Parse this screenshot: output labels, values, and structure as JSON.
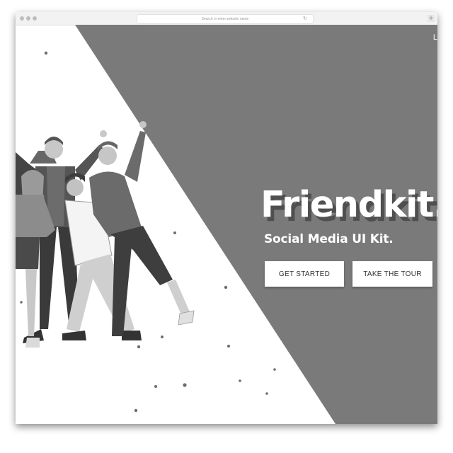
{
  "browser": {
    "url_placeholder": "Search or enter website name",
    "reload_icon": "reload-icon",
    "new_tab_icon": "plus-icon",
    "new_tab_glyph": "+"
  },
  "hero": {
    "title": "Friendkit.",
    "subtitle": "Social Media UI Kit.",
    "corner_text": "L",
    "buttons": {
      "start": "GET STARTED",
      "tour": "TAKE THE TOUR"
    },
    "illustration": "group-of-friends-illustration"
  },
  "colors": {
    "hero_panel": "#7a7a7a",
    "page_background": "#ffffff",
    "button_text": "#333333"
  }
}
